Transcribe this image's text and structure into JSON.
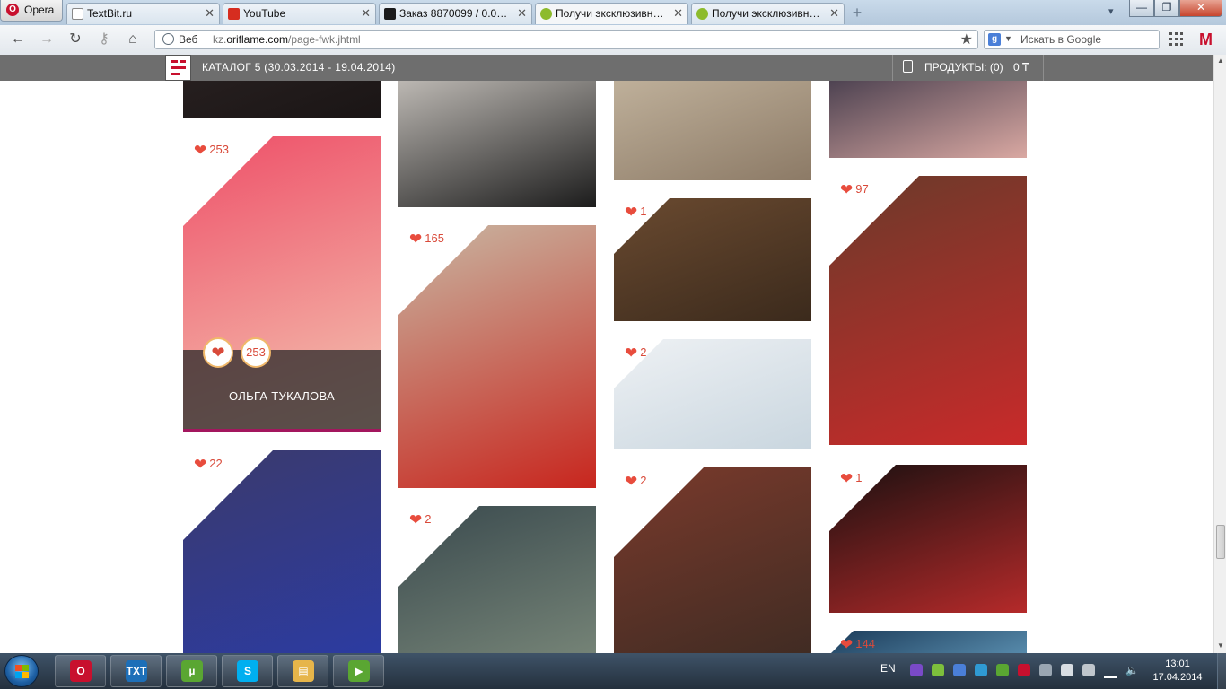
{
  "browser": {
    "menu_label": "Opera",
    "tabs": [
      {
        "title": "TextBit.ru",
        "active": false,
        "favicon": "page-icon"
      },
      {
        "title": "YouTube",
        "active": false,
        "favicon": "youtube-icon"
      },
      {
        "title": "Заказ 8870099 / 0.05 у...",
        "active": false,
        "favicon": "advego-icon"
      },
      {
        "title": "Получи эксклюзивно...",
        "active": true,
        "favicon": "oriflame-icon"
      },
      {
        "title": "Получи эксклюзивно...",
        "active": false,
        "favicon": "oriflame-icon"
      }
    ],
    "address": {
      "scheme_label": "Веб",
      "url_prefix": "kz.",
      "url_domain": "oriflame.com",
      "url_path": "/page-fwk.jhtml"
    },
    "search": {
      "engine_letter": "g",
      "placeholder": "Искать в Google"
    },
    "gmail_letter": "M"
  },
  "site_header": {
    "catalog": "КАТАЛОГ 5  (30.03.2014 - 19.04.2014)",
    "cart_label": "ПРОДУКТЫ: (0)",
    "cart_total": "0 ₸"
  },
  "gallery": {
    "columns": [
      [
        {
          "likes": null,
          "colors": [
            "#2a2222",
            "#1a1515"
          ]
        },
        {
          "likes": "253",
          "colors": [
            "#ee4f68",
            "#f4c7b3"
          ],
          "featured": true,
          "name": "ОЛЬГА ТУКАЛОВА",
          "like_count": "253"
        },
        {
          "likes": "22",
          "colors": [
            "#3b3a6c",
            "#2a3ba7"
          ]
        }
      ],
      [
        {
          "likes": null,
          "colors": [
            "#d9d4ce",
            "#1c1c1c"
          ]
        },
        {
          "likes": "165",
          "colors": [
            "#c8b7a3",
            "#c8261e"
          ]
        },
        {
          "likes": "2",
          "colors": [
            "#3a4a4e",
            "#7d8b7c"
          ]
        }
      ],
      [
        {
          "likes": null,
          "colors": [
            "#c9bba5",
            "#8c7a66"
          ]
        },
        {
          "likes": "1",
          "colors": [
            "#6a4a30",
            "#3b2a1c"
          ]
        },
        {
          "likes": "2",
          "colors": [
            "#eef1f4",
            "#c9d6df"
          ]
        },
        {
          "likes": "2",
          "colors": [
            "#7a3a2c",
            "#3a2a22"
          ]
        }
      ],
      [
        {
          "likes": null,
          "colors": [
            "#2c2a3e",
            "#d9a8a2"
          ]
        },
        {
          "likes": "97",
          "colors": [
            "#6a3a2a",
            "#c92a2a"
          ]
        },
        {
          "likes": "1",
          "colors": [
            "#1a1010",
            "#b52a2a"
          ]
        },
        {
          "likes": "144",
          "colors": [
            "#1c3c5a",
            "#6aa4c6"
          ]
        }
      ]
    ]
  },
  "taskbar": {
    "apps": [
      {
        "name": "opera",
        "label": "O",
        "color": "#c8102e"
      },
      {
        "name": "txtru",
        "label": "TXT",
        "color": "#1d6fb8"
      },
      {
        "name": "utorrent",
        "label": "µ",
        "color": "#5aa632"
      },
      {
        "name": "skype",
        "label": "S",
        "color": "#00aff0"
      },
      {
        "name": "explorer",
        "label": "▤",
        "color": "#e6b54a"
      },
      {
        "name": "media",
        "label": "▶",
        "color": "#5aa632"
      }
    ],
    "language": "EN",
    "time": "13:01",
    "date": "17.04.2014"
  }
}
